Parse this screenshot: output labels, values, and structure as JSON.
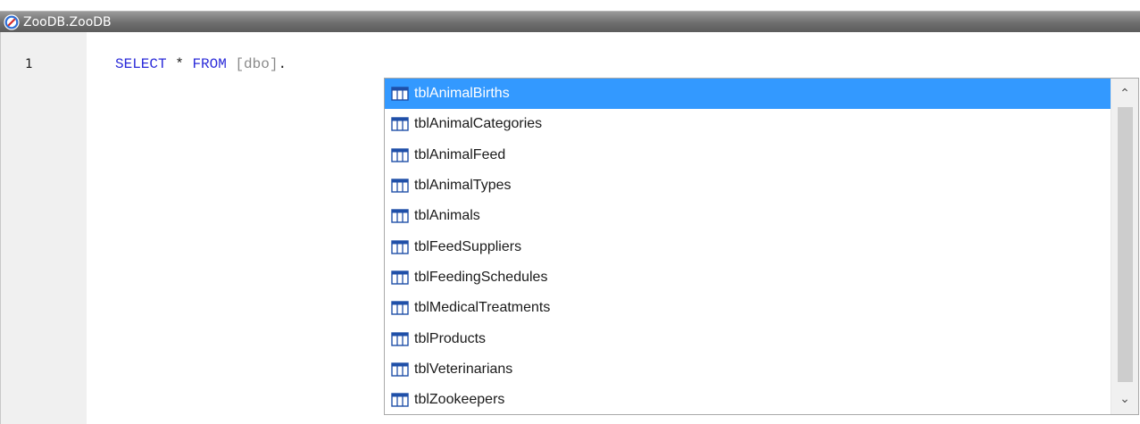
{
  "window": {
    "title": "ZooDB.ZooDB",
    "icon": "database-connection-icon"
  },
  "editor": {
    "line_number": "1",
    "tokens": {
      "kw_select": "SELECT",
      "star": "*",
      "kw_from": "FROM",
      "schema": "[dbo]",
      "dot": "."
    }
  },
  "autocomplete": {
    "item_icon": "table-icon",
    "selected_index": 0,
    "items": [
      {
        "label": "tblAnimalBirths"
      },
      {
        "label": "tblAnimalCategories"
      },
      {
        "label": "tblAnimalFeed"
      },
      {
        "label": "tblAnimalTypes"
      },
      {
        "label": "tblAnimals"
      },
      {
        "label": "tblFeedSuppliers"
      },
      {
        "label": "tblFeedingSchedules"
      },
      {
        "label": "tblMedicalTreatments"
      },
      {
        "label": "tblProducts"
      },
      {
        "label": "tblVeterinarians"
      },
      {
        "label": "tblZookeepers"
      }
    ],
    "scroll_up_glyph": "⌃",
    "scroll_down_glyph": "⌄"
  },
  "colors": {
    "selection": "#3399ff",
    "keyword": "#2b2bd9",
    "identifier": "#8a8a8a",
    "titlebar": "#6e6e6e"
  }
}
